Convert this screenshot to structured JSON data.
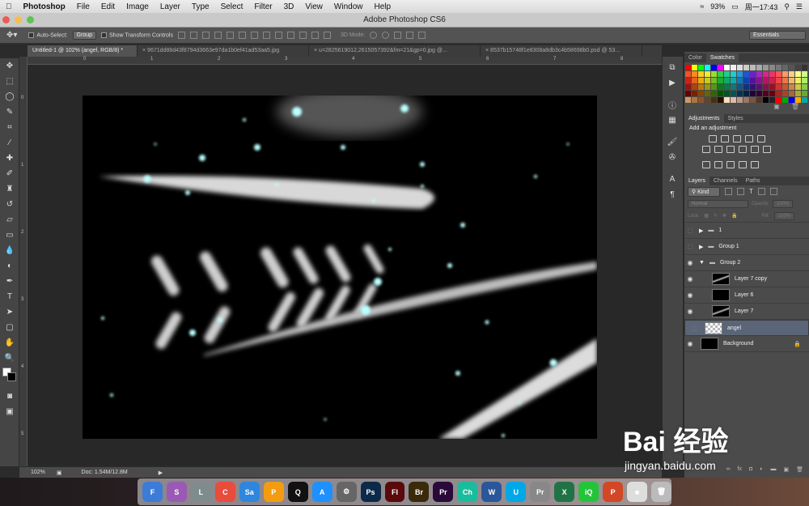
{
  "menubar": {
    "app": "Photoshop",
    "items": [
      "File",
      "Edit",
      "Image",
      "Layer",
      "Type",
      "Select",
      "Filter",
      "3D",
      "View",
      "Window",
      "Help"
    ],
    "battery": "93%",
    "clock": "周一17:43"
  },
  "window": {
    "title": "Adobe Photoshop CS6"
  },
  "options": {
    "auto_select_label": "Auto-Select:",
    "auto_select_value": "Group",
    "transform_label": "Show Transform Controls",
    "mode_label": "3D Mode:",
    "workspace": "Essentials"
  },
  "tabs": [
    {
      "label": "Untitled-1 @ 102% (angel, RGB/8) *"
    },
    {
      "label": "9671dd88d43f8794d3663e97da1b0ef41ad53aa5.jpg"
    },
    {
      "label": "u=2825619012,2615057392&fm=21&gp=0.jpg @..."
    },
    {
      "label": "8537b15748f1e8308a8db3c4b58698b0.psd @ 53..."
    }
  ],
  "ruler_top": [
    "0",
    "1",
    "2",
    "3",
    "4",
    "5",
    "6",
    "7",
    "8"
  ],
  "ruler_left": [
    "0",
    "1",
    "2",
    "3",
    "4",
    "5"
  ],
  "status": {
    "zoom": "102%",
    "doc": "Doc: 1.54M/12.8M"
  },
  "panels": {
    "color_tabs": [
      "Color",
      "Swatches"
    ],
    "adjust_tabs": [
      "Adjustments",
      "Styles"
    ],
    "adjust_title": "Add an adjustment",
    "layer_tabs": [
      "Layers",
      "Channels",
      "Paths"
    ],
    "kind": "Kind",
    "blend": "Normal",
    "opacity_label": "Opacity:",
    "opacity": "100%",
    "lock_label": "Lock:",
    "fill_label": "Fill:",
    "fill": "100%"
  },
  "layers": [
    {
      "name": "1",
      "type": "group",
      "indent": 0
    },
    {
      "name": "Group 1",
      "type": "group",
      "indent": 0
    },
    {
      "name": "Group 2",
      "type": "group-open",
      "indent": 0
    },
    {
      "name": "Layer 7 copy",
      "type": "layer",
      "indent": 1
    },
    {
      "name": "Layer 6",
      "type": "layer",
      "indent": 1
    },
    {
      "name": "Layer 7",
      "type": "layer",
      "indent": 1
    },
    {
      "name": "angel",
      "type": "transparent",
      "indent": 0
    },
    {
      "name": "Background",
      "type": "background",
      "indent": 0
    }
  ],
  "dock": [
    {
      "label": "F",
      "color": "#3d7bd9"
    },
    {
      "label": "S",
      "color": "#9b59b6"
    },
    {
      "label": "L",
      "color": "#7f8c8d"
    },
    {
      "label": "C",
      "color": "#e74c3c"
    },
    {
      "label": "Sa",
      "color": "#2e86de"
    },
    {
      "label": "P",
      "color": "#f39c12"
    },
    {
      "label": "Q",
      "color": "#111111"
    },
    {
      "label": "A",
      "color": "#1e90ff"
    },
    {
      "label": "⚙",
      "color": "#666666"
    },
    {
      "label": "Ps",
      "color": "#0b2a4a"
    },
    {
      "label": "Fl",
      "color": "#5a0a0a"
    },
    {
      "label": "Br",
      "color": "#3a2a0a"
    },
    {
      "label": "Pr",
      "color": "#2a0a3a"
    },
    {
      "label": "Ch",
      "color": "#1abc9c"
    },
    {
      "label": "W",
      "color": "#2b579a"
    },
    {
      "label": "U",
      "color": "#00a8e8"
    },
    {
      "label": "Pr",
      "color": "#888888"
    },
    {
      "label": "X",
      "color": "#217346"
    },
    {
      "label": "iQ",
      "color": "#23c43a"
    },
    {
      "label": "P",
      "color": "#d24726"
    },
    {
      "label": "■",
      "color": "#dddddd"
    },
    {
      "label": "🗑",
      "color": "#bbbbbb"
    }
  ],
  "watermark": {
    "text": "Bai 经验",
    "sub": "jingyan.baidu.com"
  }
}
